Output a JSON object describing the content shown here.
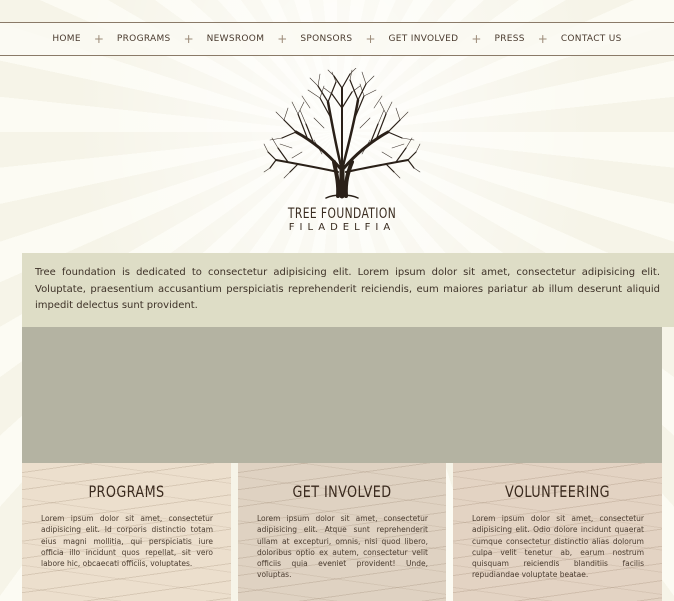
{
  "nav": {
    "items": [
      "HOME",
      "PROGRAMS",
      "NEWSROOM",
      "SPONSORS",
      "GET INVOLVED",
      "PRESS",
      "CONTACT US"
    ],
    "separator": "+"
  },
  "brand": {
    "line1": "TREE FOUNDATION",
    "line2": "FILADELFIA"
  },
  "intro": {
    "text": "Tree foundation is dedicated to consectetur adipisicing elit. Lorem ipsum dolor sit amet, consectetur adipisicing elit. Voluptate, praesentium accusantium perspiciatis reprehenderit reiciendis, eum maiores pariatur ab illum deserunt aliquid impedit delectus sunt provident."
  },
  "cards": [
    {
      "title": "PROGRAMS",
      "body": "Lorem ipsum dolor sit amet, consectetur adipisicing elit. Id corporis distinctio totam eius magni mollitia, qui perspiciatis iure officia illo incidunt quos repellat, sit vero labore hic, obcaecati officiis, voluptates."
    },
    {
      "title": "GET INVOLVED",
      "body": "Lorem ipsum dolor sit amet, consectetur adipisicing elit. Atque sunt reprehenderit ullam at excepturi, omnis, nisi quod libero, doloribus optio ex autem, consectetur velit officiis quia eveniet provident! Unde, voluptas."
    },
    {
      "title": "VOLUNTEERING",
      "body": "Lorem ipsum dolor sit amet, consectetur adipisicing elit. Odio dolore incidunt quaerat cumque consectetur distinctio alias dolorum culpa velit tenetur ab, earum nostrum quisquam reiciendis blanditiis facilis repudiandae voluptate beatae."
    }
  ],
  "colors": {
    "intro_band": "#deddc6",
    "slider": "#b4b3a2",
    "text": "#3a2f25"
  }
}
